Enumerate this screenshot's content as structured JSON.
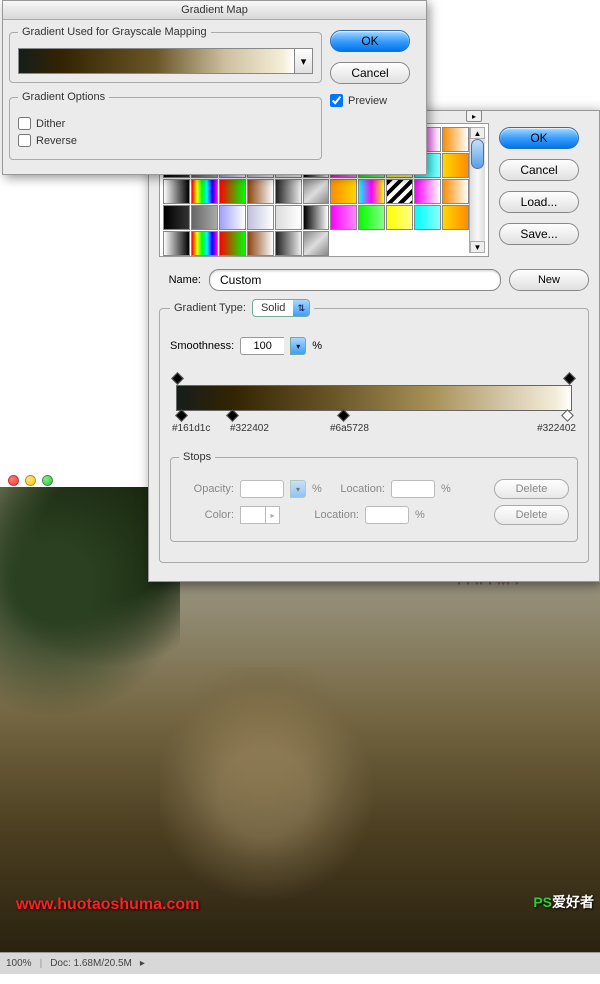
{
  "dialog1": {
    "title": "Gradient Map",
    "grayscale_legend": "Gradient Used for Grayscale Mapping",
    "options_legend": "Gradient Options",
    "dither_label": "Dither",
    "reverse_label": "Reverse",
    "ok": "OK",
    "cancel": "Cancel",
    "preview_label": "Preview",
    "preview_checked": true
  },
  "dialog2": {
    "ok": "OK",
    "cancel": "Cancel",
    "load": "Load...",
    "save": "Save...",
    "name_label": "Name:",
    "name_value": "Custom",
    "new_btn": "New",
    "grad_type_label": "Gradient Type:",
    "grad_type_value": "Solid",
    "smoothness_label": "Smoothness:",
    "smoothness_value": "100",
    "smoothness_unit": "%",
    "stops": [
      {
        "hex": "#161d1c",
        "pos": 0
      },
      {
        "hex": "#322402",
        "pos": 13
      },
      {
        "hex": "#6a5728",
        "pos": 41
      },
      {
        "hex": "#322402",
        "pos": 98
      }
    ],
    "stops_legend": "Stops",
    "opacity_label": "Opacity:",
    "color_label": "Color:",
    "location_label": "Location:",
    "pct": "%",
    "delete": "Delete"
  },
  "image": {
    "zoom": "100%",
    "doc_info": "Doc: 1.68M/20.5M",
    "watermark1": "www.huotaoshuma.com",
    "watermark2_green": "PS",
    "watermark2_white": "爱好者"
  },
  "presets": [
    "linear-gradient(to right,#fff,#000)",
    "linear-gradient(to right,#f00,#ff0,#0f0,#0ff,#00f,#f0f)",
    "linear-gradient(to right,#f00,#0f0)",
    "linear-gradient(to right,#8b4513,#fff)",
    "linear-gradient(to right,#222,#eee)",
    "linear-gradient(to bottom right,#888,#ddd 50%,#888)",
    "linear-gradient(to right,#ff8c00,#ffd700)",
    "linear-gradient(to right,#0ff,#f0f,#ff0)",
    "repeating-linear-gradient(135deg,#000 0 4px,#fff 4px 8px)",
    "linear-gradient(to right,#f0f,#fff)",
    "linear-gradient(to right,#ff8c00,#fff)",
    "linear-gradient(to right,#000,#333)",
    "linear-gradient(to right,#666,#aaa)",
    "linear-gradient(to right,#a0a0ff,#fff)",
    "linear-gradient(to right,#c0c0e0,#fff)",
    "linear-gradient(to right,#ddd,#fff)",
    "linear-gradient(to right,#000,#fff)",
    "linear-gradient(to right,#f0f,#f8f)",
    "linear-gradient(to right,#0f0,#8f8)",
    "linear-gradient(to right,#ff0,#ff8)",
    "linear-gradient(to right,#0ff,#8ff)",
    "linear-gradient(to right,#ffd700,#ff8c00)"
  ]
}
